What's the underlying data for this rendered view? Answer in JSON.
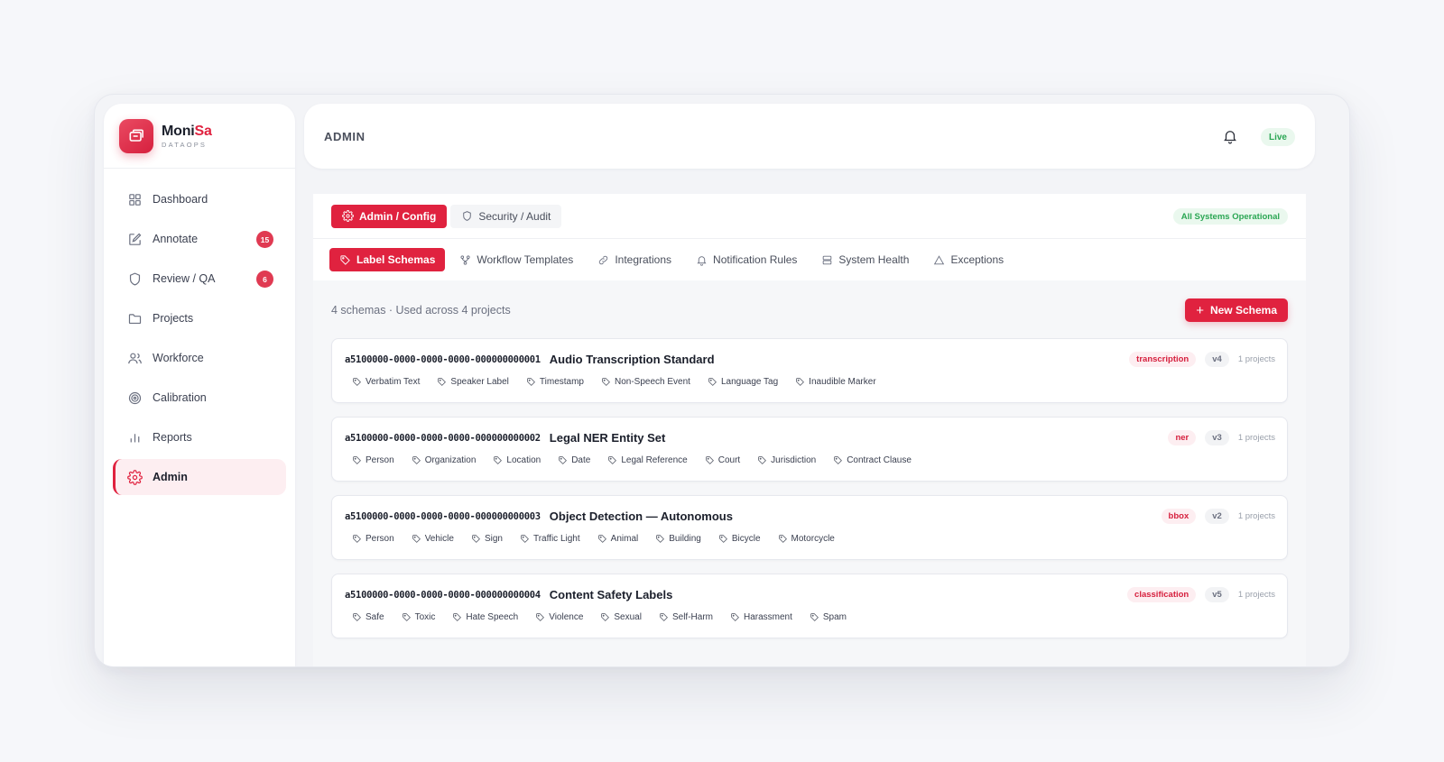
{
  "brand": {
    "name_prefix": "Moni",
    "name_accent": "Sa",
    "subtitle": "DATAOPS"
  },
  "sidebar": {
    "items": [
      {
        "label": "Dashboard",
        "icon": "grid-icon"
      },
      {
        "label": "Annotate",
        "icon": "edit-icon",
        "badge": "15"
      },
      {
        "label": "Review / QA",
        "icon": "shield-icon",
        "badge": "6"
      },
      {
        "label": "Projects",
        "icon": "folder-icon"
      },
      {
        "label": "Workforce",
        "icon": "users-icon"
      },
      {
        "label": "Calibration",
        "icon": "target-icon"
      },
      {
        "label": "Reports",
        "icon": "bar-chart-icon"
      },
      {
        "label": "Admin",
        "icon": "gear-icon",
        "active": true
      }
    ]
  },
  "header": {
    "title": "ADMIN",
    "status": "Live"
  },
  "section_tabs": [
    {
      "label": "Admin / Config",
      "icon": "gear-icon",
      "active": true
    },
    {
      "label": "Security / Audit",
      "icon": "shield-icon"
    }
  ],
  "system_status": "All Systems Operational",
  "sub_tabs": [
    {
      "label": "Label Schemas",
      "icon": "tag-icon",
      "active": true
    },
    {
      "label": "Workflow Templates",
      "icon": "workflow-icon"
    },
    {
      "label": "Integrations",
      "icon": "link-icon"
    },
    {
      "label": "Notification Rules",
      "icon": "bell-icon"
    },
    {
      "label": "System Health",
      "icon": "server-icon"
    },
    {
      "label": "Exceptions",
      "icon": "warning-icon"
    }
  ],
  "summary": "4 schemas · Used across 4 projects",
  "new_button": "New Schema",
  "schemas": [
    {
      "id": "a5100000-0000-0000-0000-000000000001",
      "name": "Audio Transcription Standard",
      "type": "transcription",
      "version": "v4",
      "projects": "1 projects",
      "labels": [
        "Verbatim Text",
        "Speaker Label",
        "Timestamp",
        "Non-Speech Event",
        "Language Tag",
        "Inaudible Marker"
      ]
    },
    {
      "id": "a5100000-0000-0000-0000-000000000002",
      "name": "Legal NER Entity Set",
      "type": "ner",
      "version": "v3",
      "projects": "1 projects",
      "labels": [
        "Person",
        "Organization",
        "Location",
        "Date",
        "Legal Reference",
        "Court",
        "Jurisdiction",
        "Contract Clause"
      ]
    },
    {
      "id": "a5100000-0000-0000-0000-000000000003",
      "name": "Object Detection — Autonomous",
      "type": "bbox",
      "version": "v2",
      "projects": "1 projects",
      "labels": [
        "Person",
        "Vehicle",
        "Sign",
        "Traffic Light",
        "Animal",
        "Building",
        "Bicycle",
        "Motorcycle"
      ]
    },
    {
      "id": "a5100000-0000-0000-0000-000000000004",
      "name": "Content Safety Labels",
      "type": "classification",
      "version": "v5",
      "projects": "1 projects",
      "labels": [
        "Safe",
        "Toxic",
        "Hate Speech",
        "Violence",
        "Sexual",
        "Self-Harm",
        "Harassment",
        "Spam"
      ]
    }
  ],
  "colors": {
    "accent": "#e0223f",
    "success": "#2aa653"
  }
}
